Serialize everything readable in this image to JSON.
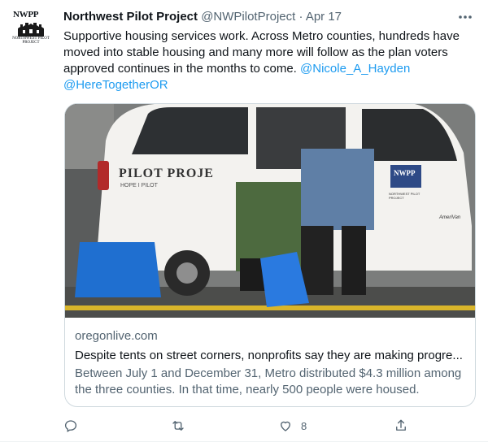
{
  "account": {
    "name": "Northwest Pilot Project",
    "handle": "@NWPilotProject",
    "date": "Apr 17",
    "avatar_text": "NWPP",
    "avatar_sub": "NORTHWEST PILOT PROJECT"
  },
  "tweet": {
    "text": "Supportive housing services work. Across Metro counties, hundreds have moved into stable housing and many more will follow as the plan voters approved continues in the months to come.",
    "mentions": [
      "@Nicole_A_Hayden",
      "@HereTogetherOR"
    ]
  },
  "card": {
    "domain": "oregonlive.com",
    "title": "Despite tents on street corners, nonprofits say they are making progre...",
    "description": "Between July 1 and December 31, Metro distributed $4.3 million among the three counties. In that time, nearly 500 people were housed.",
    "image_van_text": "PILOT PROJE",
    "image_tagline": "HOPE I PILOT",
    "image_logo": "NWPP",
    "image_logo_sub": "NORTHWEST PILOT PROJECT",
    "image_brand": "AmeriVan"
  },
  "actions": {
    "reply_icon": "reply-icon",
    "retweet_icon": "retweet-icon",
    "like_icon": "like-icon",
    "like_count": "8",
    "share_icon": "share-icon"
  },
  "colors": {
    "link": "#1d9bf0",
    "secondary_text": "#536471",
    "border": "#cfd9de"
  }
}
